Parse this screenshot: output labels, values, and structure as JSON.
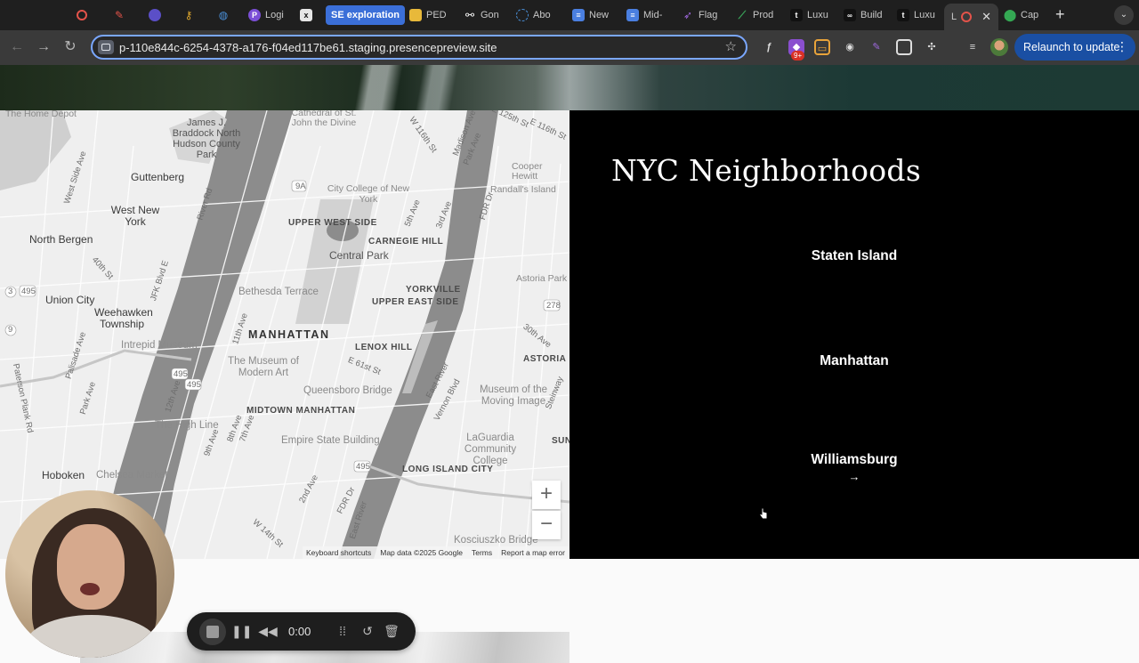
{
  "browser": {
    "tabs": [
      {
        "label": "",
        "icon": "record-icon",
        "color": "#e3534a"
      },
      {
        "label": "",
        "icon": "red-app-icon",
        "color": "#e3534a"
      },
      {
        "label": "",
        "icon": "purple-orb-icon",
        "color": "#6a5acd"
      },
      {
        "label": "",
        "icon": "key-icon",
        "color": "#e0a82e"
      },
      {
        "label": "",
        "icon": "globe-icon",
        "color": "#4a90d9"
      },
      {
        "label": "Logi",
        "icon": "logo-icon",
        "color": "#7b4fd6"
      },
      {
        "label": "x",
        "icon": "x-icon",
        "color": "#444"
      },
      {
        "label": "SE exploration",
        "icon": "",
        "color": "#3b6fd8"
      },
      {
        "label": "PED",
        "icon": "folder-icon",
        "color": "#e8b93a"
      },
      {
        "label": "Gon",
        "icon": "chain-icon",
        "color": "#222"
      },
      {
        "label": "Abo",
        "icon": "circle-icon",
        "color": "#4a90d9"
      },
      {
        "label": "New",
        "icon": "doc-icon",
        "color": "#4a7fe0"
      },
      {
        "label": "Mid-",
        "icon": "doc-icon",
        "color": "#4a7fe0"
      },
      {
        "label": "Flag",
        "icon": "rocket-icon",
        "color": "#a06ae0"
      },
      {
        "label": "Prod",
        "icon": "chart-icon",
        "color": "#3aa65a"
      },
      {
        "label": "Luxu",
        "icon": "brand-icon",
        "color": "#111"
      },
      {
        "label": "Build",
        "icon": "build-icon",
        "color": "#111"
      },
      {
        "label": "Luxu",
        "icon": "brand-icon",
        "color": "#111"
      },
      {
        "label": "L",
        "icon": "record-icon",
        "color": "#e3534a"
      },
      {
        "label": "Cap",
        "icon": "map-pin-icon",
        "color": "#34a853"
      }
    ],
    "active_tab_index": 18,
    "new_tab": "+",
    "tab_search": "⌄",
    "url": "p-110e844c-6254-4378-a176-f04ed117be61.staging.presencepreview.site",
    "extension_badge": "9+",
    "relaunch_label": "Relaunch to update",
    "relaunch_menu": "⋮"
  },
  "map": {
    "labels": {
      "home_depot": "The Home Depot",
      "cathedral": "Cathedral of St. John the Divine",
      "james": "James J. Braddock North Hudson County Park",
      "guttenberg": "Guttenberg",
      "west_new_york": "West New York",
      "north_bergen": "North Bergen",
      "union_city": "Union City",
      "weehawken": "Weehawken Township",
      "hoboken": "Hoboken",
      "chelsea": "Chelsea Market",
      "upper_west": "UPPER WEST SIDE",
      "carnegie": "CARNEGIE HILL",
      "central_park": "Central Park",
      "yorkville": "YORKVILLE",
      "upper_east": "UPPER EAST SIDE",
      "bethesda": "Bethesda Terrace",
      "manhattan": "MANHATTAN",
      "lenox": "LENOX HILL",
      "moma": "The Museum of Modern Art",
      "intrepid": "Intrepid Museum",
      "queensboro": "Queensboro Bridge",
      "museum_image": "Museum of the Moving Image",
      "midtown": "MIDTOWN MANHATTAN",
      "high_line": "The High Line",
      "empire": "Empire State Building",
      "astoria": "ASTORIA",
      "astoria_park": "Astoria Park",
      "laguardia": "LaGuardia Community College",
      "lic": "LONG ISLAND CITY",
      "sunnyside": "SUN SID",
      "kosciuszko": "Kosciuszko Bridge",
      "cooper_hewitt": "Cooper Hewitt",
      "randalls": "Randall's Island",
      "ccny": "City College of New York",
      "w116": "W 116th St",
      "madison": "Madison Ave",
      "park_ave": "Park Ave",
      "fifth": "5th Ave",
      "third": "3rd Ave",
      "fdr": "FDR Dr",
      "east_river": "East River",
      "vernon": "Vernon Blvd",
      "eighth": "8th Ave",
      "seventh": "7th Ave",
      "ninth": "9th Ave",
      "eleventh": "11th Ave",
      "twelfth": "12th Ave",
      "west_side": "West Side Ave",
      "kennedy": "JFK Blvd E",
      "palisade": "Palisade Ave",
      "paterson": "Paterson Plank Rd",
      "park_ave_nj": "Park Ave",
      "e61": "E 61st St",
      "w14": "W 14th St",
      "second": "2nd Ave",
      "thirtieth": "30th Ave",
      "steinway": "Steinway",
      "hwy_9a": "9A",
      "hwy_495": "495",
      "hwy_278": "278",
      "hwy_3": "3",
      "hwy_9": "9",
      "river_rd": "River Rd",
      "fortieth": "40th St",
      "e116": "E 116th St",
      "e125": "E 125th St"
    },
    "zoom_in": "+",
    "zoom_out": "−",
    "footer": {
      "shortcuts": "Keyboard shortcuts",
      "data": "Map data ©2025 Google",
      "terms": "Terms",
      "report": "Report a map error"
    }
  },
  "panel": {
    "title": "NYC Neighborhoods",
    "neighborhoods": [
      "Staten Island",
      "Manhattan",
      "Williamsburg"
    ],
    "arrow": "→"
  },
  "recorder": {
    "time": "0:00"
  },
  "colors": {
    "panel_bg": "#000000",
    "map_bg": "#efefef",
    "water": "#8c8c8c",
    "park": "#d2d2d2",
    "relaunch": "#1a4fa3"
  }
}
